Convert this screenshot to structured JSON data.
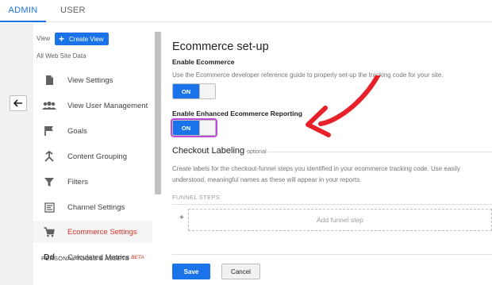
{
  "tabs": {
    "admin": "ADMIN",
    "user": "USER"
  },
  "nav": {
    "view_label": "View",
    "create_view": "Create View",
    "site_data": "All Web Site Data",
    "items": [
      {
        "label": "View Settings",
        "icon": "document-icon"
      },
      {
        "label": "View User Management",
        "icon": "users-icon"
      },
      {
        "label": "Goals",
        "icon": "flag-icon"
      },
      {
        "label": "Content Grouping",
        "icon": "grouping-icon"
      },
      {
        "label": "Filters",
        "icon": "filter-icon"
      },
      {
        "label": "Channel Settings",
        "icon": "channel-icon"
      },
      {
        "label": "Ecommerce Settings",
        "icon": "cart-icon",
        "active": true
      },
      {
        "label": "Calculated Metrics",
        "icon": "dd-icon",
        "badge": "BETA"
      }
    ],
    "section_head": "PERSONAL TOOLS & ASSETS"
  },
  "content": {
    "title": "Ecommerce set-up",
    "enable_label": "Enable Ecommerce",
    "enable_desc": "Use the Ecommerce developer reference guide to properly set-up the tracking code for your site.",
    "enable_toggle": "ON",
    "enhanced_label": "Enable Enhanced Ecommerce Reporting",
    "enhanced_toggle": "ON",
    "checkout_title": "Checkout Labeling",
    "checkout_optional": "optional",
    "checkout_desc_1": "Create labels for the checkout-funnel steps you identified in your ecommerce tracking code. Use easily",
    "checkout_desc_2": "understood, meaningful names as these will appear in your reports.",
    "funnel_head": "FUNNEL STEPS",
    "plus": "+",
    "add_step": "Add funnel step",
    "save": "Save",
    "cancel": "Cancel"
  },
  "colors": {
    "accent": "#1a73e8",
    "active_red": "#d93025",
    "annotation_arrow": "#e8202a",
    "highlight": "#c04ad8"
  }
}
